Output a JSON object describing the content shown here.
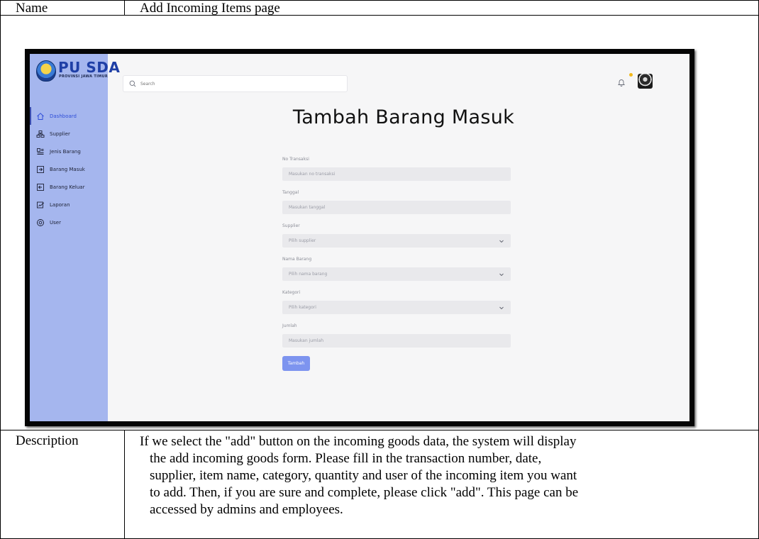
{
  "doc": {
    "name_label": "Name",
    "name_value": "Add Incoming Items page",
    "description_label": "Description",
    "description_lines": [
      "If we select the \"add\" button on the incoming goods data, the system will display",
      "the add incoming goods form. Please fill in the transaction number, date,",
      "supplier, item name, category, quantity and user of the incoming item you want",
      "to add. Then, if you are sure and complete, please click \"add\". This page can be",
      "accessed by admins and employees."
    ]
  },
  "app": {
    "logo": {
      "title": "PU SDA",
      "subtitle": "PROVINSI JAWA TIMUR"
    },
    "search": {
      "placeholder": "Search"
    },
    "sidebar": {
      "items": [
        {
          "label": "Dashboard",
          "icon": "home-icon",
          "active": true
        },
        {
          "label": "Supplier",
          "icon": "supplier-icon",
          "active": false
        },
        {
          "label": "Jenis Barang",
          "icon": "item-type-icon",
          "active": false
        },
        {
          "label": "Barang Masuk",
          "icon": "incoming-goods-icon",
          "active": false
        },
        {
          "label": "Barang Keluar",
          "icon": "outgoing-goods-icon",
          "active": false
        },
        {
          "label": "Laporan",
          "icon": "report-icon",
          "active": false
        },
        {
          "label": "User",
          "icon": "user-gear-icon",
          "active": false
        }
      ]
    },
    "page_title": "Tambah Barang Masuk",
    "form": {
      "fields": [
        {
          "label": "No Transaksi",
          "placeholder": "Masukan no transaksi",
          "type": "text"
        },
        {
          "label": "Tanggal",
          "placeholder": "Masukan tanggal",
          "type": "text"
        },
        {
          "label": "Supplier",
          "placeholder": "Pilih supplier",
          "type": "select"
        },
        {
          "label": "Nama Barang",
          "placeholder": "Pilih nama barang",
          "type": "select"
        },
        {
          "label": "Kategori",
          "placeholder": "Pilih kategori",
          "type": "select"
        },
        {
          "label": "Jumlah",
          "placeholder": "Masukan jumlah",
          "type": "text"
        }
      ],
      "submit_label": "Tambah"
    },
    "colors": {
      "sidebar": "#a5b6ee",
      "active_nav": "#2f4ed8",
      "button": "#7d94ef",
      "notification_dot": "#f2b81a"
    }
  }
}
